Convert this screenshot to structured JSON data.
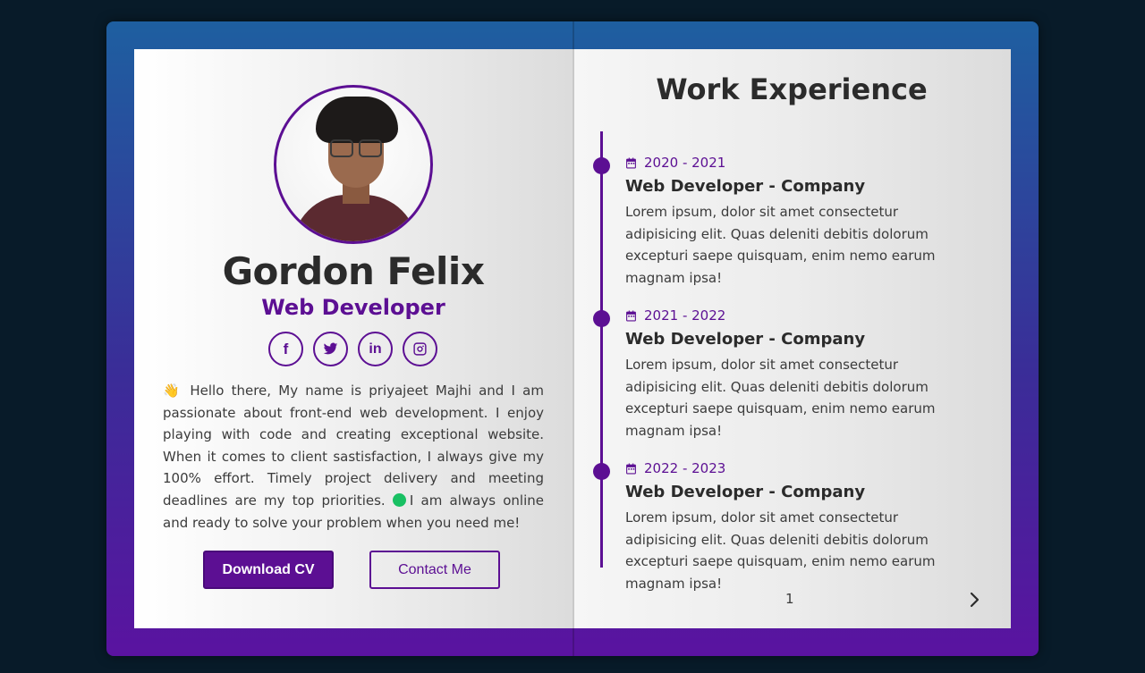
{
  "profile": {
    "name": "Gordon Felix",
    "role": "Web Developer",
    "about_part1": "Hello there, My name is priyajeet Majhi and I am passionate about front-end web development. I enjoy playing with code and creating exceptional website. When it comes to client sastisfaction, I always give my 100% effort. Timely project delivery and meeting deadlines are my top priorities. ",
    "about_part2": "I am always online and ready to solve your problem when you need me!",
    "wave_emoji": "👋",
    "socials": [
      {
        "icon": "facebook-icon",
        "glyph": "f"
      },
      {
        "icon": "twitter-icon"
      },
      {
        "icon": "linkedin-icon",
        "glyph": "in"
      },
      {
        "icon": "instagram-icon"
      }
    ]
  },
  "buttons": {
    "download": "Download CV",
    "contact": "Contact Me"
  },
  "experience": {
    "title": "Work Experience",
    "items": [
      {
        "date": "2020 - 2021",
        "job": "Web Developer - Company",
        "desc": "Lorem ipsum, dolor sit amet consectetur adipisicing elit. Quas deleniti debitis dolorum excepturi saepe quisquam, enim nemo earum magnam ipsa!"
      },
      {
        "date": "2021 - 2022",
        "job": "Web Developer - Company",
        "desc": "Lorem ipsum, dolor sit amet consectetur adipisicing elit. Quas deleniti debitis dolorum excepturi saepe quisquam, enim nemo earum magnam ipsa!"
      },
      {
        "date": "2022 - 2023",
        "job": "Web Developer - Company",
        "desc": "Lorem ipsum, dolor sit amet consectetur adipisicing elit. Quas deleniti debitis dolorum excepturi saepe quisquam, enim nemo earum magnam ipsa!"
      }
    ]
  },
  "pagination": {
    "page": "1",
    "next_icon": "chevron-right-icon"
  },
  "colors": {
    "accent": "#5c0f93",
    "online": "#19c063",
    "background": "#081b29"
  }
}
